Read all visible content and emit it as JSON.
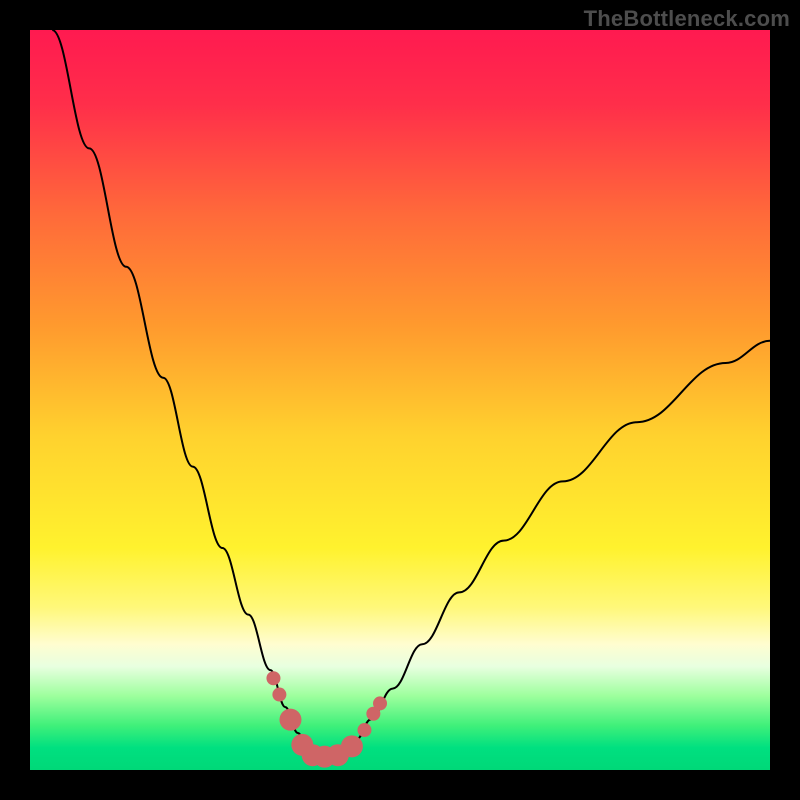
{
  "watermark": "TheBottleneck.com",
  "gradient_stops": [
    {
      "offset": 0.0,
      "color": "#ff1a50"
    },
    {
      "offset": 0.1,
      "color": "#ff2e4a"
    },
    {
      "offset": 0.25,
      "color": "#ff6a3a"
    },
    {
      "offset": 0.4,
      "color": "#ff9a2e"
    },
    {
      "offset": 0.55,
      "color": "#ffd22e"
    },
    {
      "offset": 0.7,
      "color": "#fff22e"
    },
    {
      "offset": 0.78,
      "color": "#fff87a"
    },
    {
      "offset": 0.83,
      "color": "#fffdd0"
    },
    {
      "offset": 0.86,
      "color": "#e8ffe0"
    },
    {
      "offset": 0.9,
      "color": "#9dff9d"
    },
    {
      "offset": 0.94,
      "color": "#3ff07a"
    },
    {
      "offset": 0.97,
      "color": "#00e080"
    },
    {
      "offset": 1.0,
      "color": "#00d878"
    }
  ],
  "chart_data": {
    "type": "line",
    "title": "",
    "xlabel": "",
    "ylabel": "",
    "xlim": [
      0,
      100
    ],
    "ylim": [
      0,
      100
    ],
    "series": [
      {
        "name": "bottleneck-curve",
        "x": [
          3,
          8,
          13,
          18,
          22,
          26,
          29.5,
          32.5,
          34.5,
          36.2,
          37.6,
          38.8,
          40.3,
          42.3,
          44.2,
          46,
          49,
          53,
          58,
          64,
          72,
          82,
          94,
          100
        ],
        "y": [
          100,
          84,
          68,
          53,
          41,
          30,
          21,
          13.5,
          8.5,
          5.0,
          2.8,
          1.8,
          1.8,
          2.4,
          4.2,
          6.8,
          11,
          17,
          24,
          31,
          39,
          47,
          55,
          58
        ],
        "comment": "Percent-like V-shaped curve; minimum near x≈39–41, y≈1.8"
      }
    ],
    "markers": {
      "name": "highlighted-points",
      "color": "#cf6566",
      "points_small": [
        {
          "x": 32.9,
          "y": 12.4
        },
        {
          "x": 33.7,
          "y": 10.2
        },
        {
          "x": 45.2,
          "y": 5.4
        },
        {
          "x": 46.4,
          "y": 7.6
        },
        {
          "x": 47.3,
          "y": 9.0
        }
      ],
      "points_large": [
        {
          "x": 35.2,
          "y": 6.8
        },
        {
          "x": 36.8,
          "y": 3.4
        },
        {
          "x": 38.2,
          "y": 2.0
        },
        {
          "x": 39.8,
          "y": 1.8
        },
        {
          "x": 41.6,
          "y": 2.0
        },
        {
          "x": 43.5,
          "y": 3.2
        }
      ]
    }
  }
}
